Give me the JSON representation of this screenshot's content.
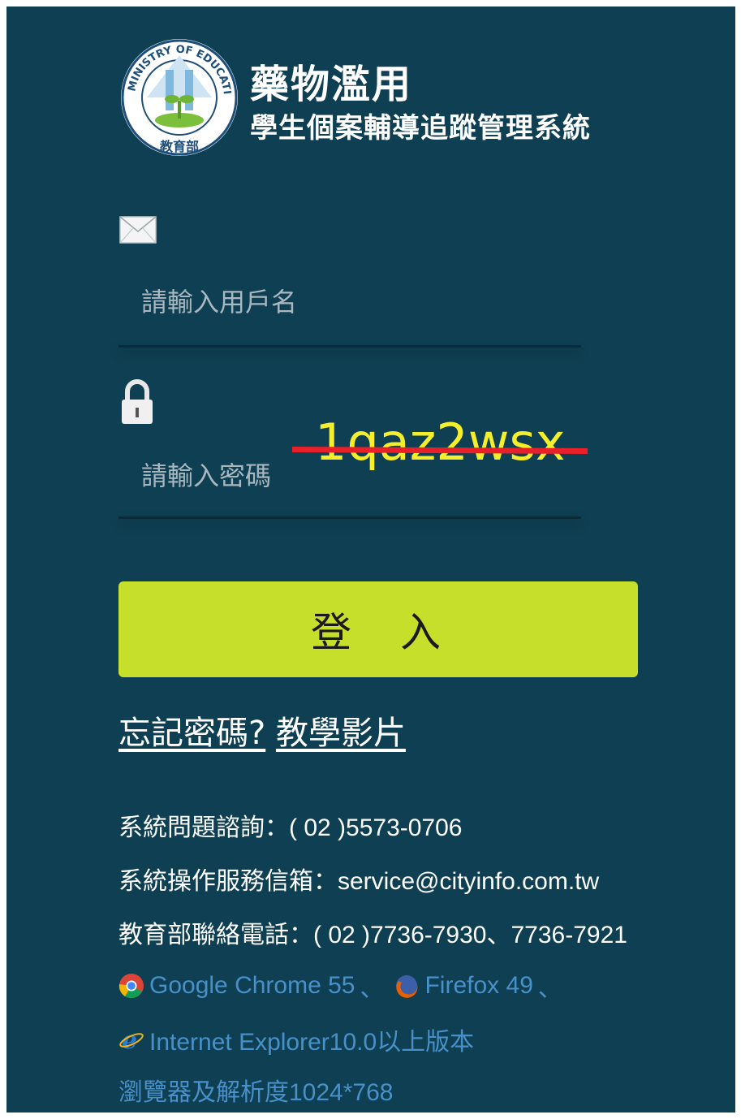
{
  "header": {
    "logo_text": "MINISTRY OF EDUCATION 教育部",
    "title": "藥物濫用",
    "subtitle": "學生個案輔導追蹤管理系統"
  },
  "login": {
    "username_placeholder": "請輸入用戶名",
    "password_placeholder": "請輸入密碼",
    "annotation_text": "1qaz2wsx",
    "submit_label": "登 入"
  },
  "links": {
    "forgot_password": "忘記密碼?",
    "tutorial_video": "教學影片"
  },
  "contact": {
    "hotline": "系統問題諮詢：( 02 )5573-0706",
    "email": "系統操作服務信箱：service@cityinfo.com.tw",
    "moe_phone": "教育部聯絡電話：( 02 )7736-7930、7736-7921"
  },
  "browsers": {
    "chrome": "Google Chrome 55",
    "firefox": "Firefox 49",
    "ie": "Internet Explorer10.0以上版本",
    "resolution": "瀏覽器及解析度1024*768",
    "separator": "、"
  },
  "colors": {
    "background": "#0e3f52",
    "button": "#c5df2a",
    "annotation": "#f4ef2a",
    "strike": "#e8202a",
    "browser_text": "#4a90c8"
  },
  "icons": {
    "username": "envelope-icon",
    "password": "lock-icon",
    "chrome": "chrome-icon",
    "firefox": "firefox-icon",
    "ie": "internet-explorer-icon"
  }
}
